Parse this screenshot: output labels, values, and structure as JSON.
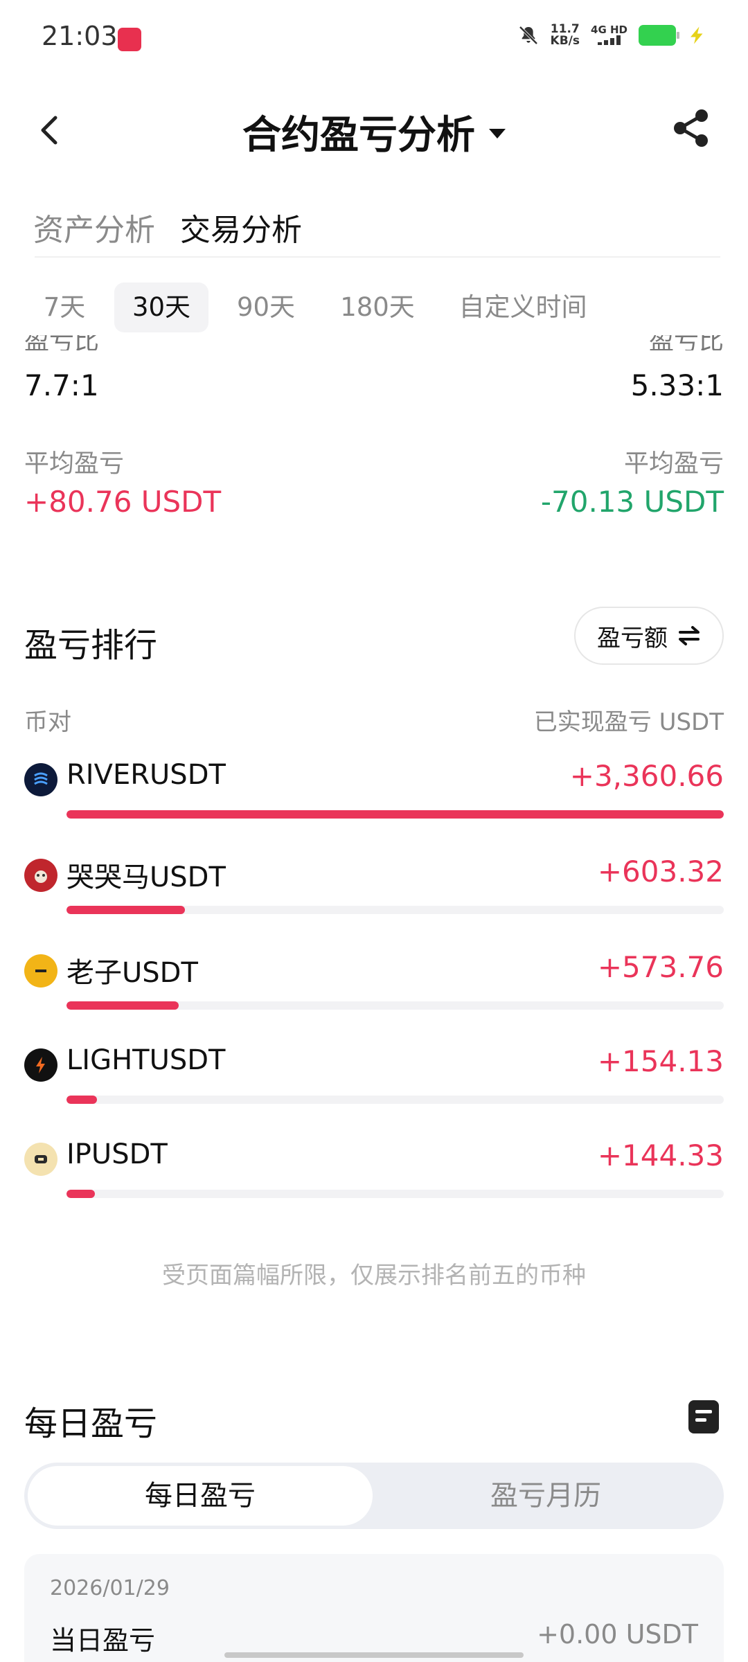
{
  "status_bar": {
    "time": "21:03",
    "net_speed_value": "11.7",
    "net_speed_unit": "KB/s",
    "signal_text": "4G HD",
    "icons": [
      "app-icon",
      "mute-bell-icon",
      "signal-icon",
      "battery-icon",
      "charging-icon"
    ],
    "battery_color": "#33d14f"
  },
  "header": {
    "title": "合约盈亏分析",
    "back_icon": "chevron-left-icon",
    "share_icon": "share-icon"
  },
  "main_tabs": [
    {
      "label": "资产分析",
      "active": false
    },
    {
      "label": "交易分析",
      "active": true
    }
  ],
  "range_tabs": [
    {
      "label": "7天",
      "active": false
    },
    {
      "label": "30天",
      "active": true
    },
    {
      "label": "90天",
      "active": false
    },
    {
      "label": "180天",
      "active": false
    },
    {
      "label": "自定义时间",
      "active": false
    }
  ],
  "stats": {
    "left_cut_label": "盈亏比",
    "right_cut_label": "盈亏比",
    "left_ratio": "7.7:1",
    "right_ratio": "5.33:1",
    "left_avg_label": "平均盈亏",
    "right_avg_label": "平均盈亏",
    "left_avg_value": "+80.76 USDT",
    "right_avg_value": "-70.13 USDT"
  },
  "ranking": {
    "title": "盈亏排行",
    "toggle_label": "盈亏额",
    "toggle_icon": "swap-icon",
    "col_pair": "币对",
    "col_pnl": "已实现盈亏 USDT",
    "items": [
      {
        "name": "RIVERUSDT",
        "value": "+3,360.66",
        "fraction": 1.0,
        "icon_color": "#0d1a3a"
      },
      {
        "name": "哭哭马USDT",
        "value": "+603.32",
        "fraction": 0.18,
        "icon_color": "#c0262d"
      },
      {
        "name": "老子USDT",
        "value": "+573.76",
        "fraction": 0.171,
        "icon_color": "#f2b417"
      },
      {
        "name": "LIGHTUSDT",
        "value": "+154.13",
        "fraction": 0.046,
        "icon_color": "#111111"
      },
      {
        "name": "IPUSDT",
        "value": "+144.33",
        "fraction": 0.043,
        "icon_color": "#f4e2b0"
      }
    ],
    "note": "受页面篇幅所限，仅展示排名前五的币种"
  },
  "daily": {
    "title": "每日盈亏",
    "doc_icon": "document-icon",
    "seg_options": [
      {
        "label": "每日盈亏",
        "active": true
      },
      {
        "label": "盈亏月历",
        "active": false
      }
    ],
    "card": {
      "date": "2026/01/29",
      "label": "当日盈亏",
      "value": "+0.00 USDT"
    }
  },
  "colors": {
    "positive": "#ea3459",
    "negative": "#21a56b",
    "muted": "#8a8a8a"
  }
}
